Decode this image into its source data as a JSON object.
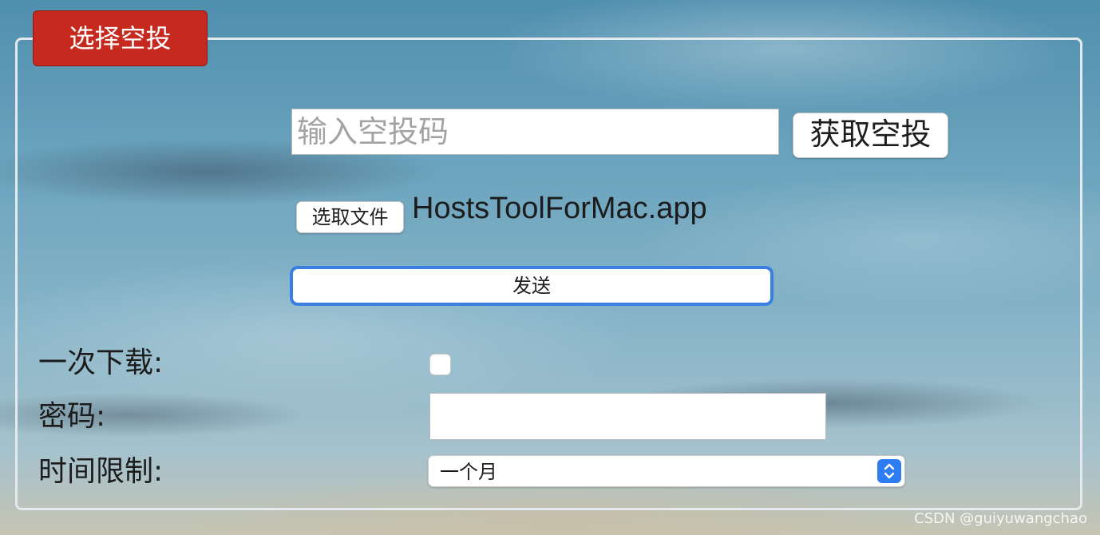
{
  "panel": {
    "legend": "选择空投"
  },
  "receive": {
    "code_placeholder": "输入空投码",
    "code_value": "",
    "fetch_label": "获取空投"
  },
  "upload": {
    "choose_file_label": "选取文件",
    "file_name": "HostsToolForMac.app",
    "send_label": "发送"
  },
  "options": {
    "once_label": "一次下载:",
    "once_checked": false,
    "password_label": "密码:",
    "password_value": "",
    "time_label": "时间限制:",
    "time_selected": "一个月"
  },
  "watermark": "CSDN @guiyuwangchao",
  "colors": {
    "legend_bg": "#c62a1e",
    "focus_ring": "#3a7fe0",
    "select_accent": "#2d7cf2"
  },
  "icons": {
    "select_arrows": "chevron-up-down-icon"
  }
}
